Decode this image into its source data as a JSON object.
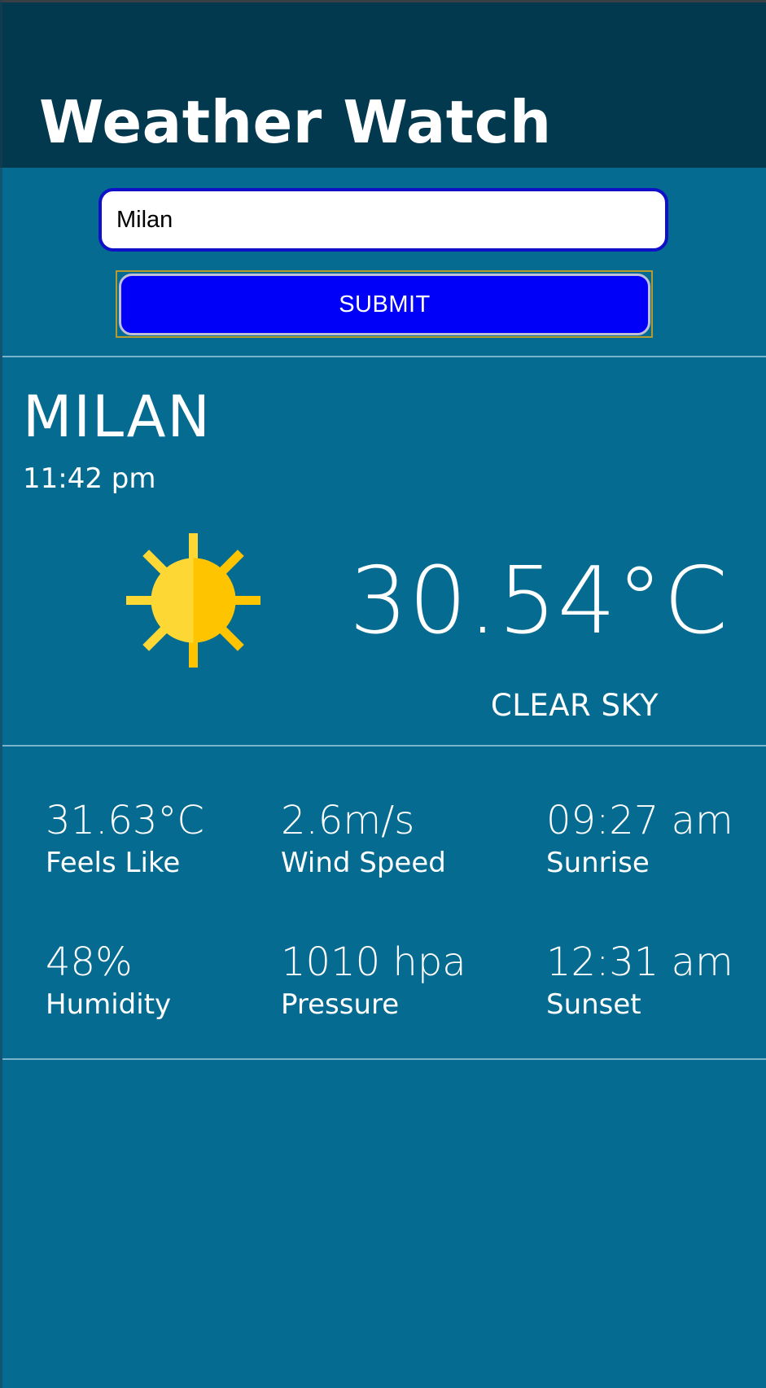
{
  "header": {
    "title": "Weather Watch"
  },
  "search": {
    "value": "Milan",
    "submit_label": "SUBMIT"
  },
  "current": {
    "city": "MILAN",
    "time": "11:42 pm",
    "temperature": "30.54°C",
    "condition": "CLEAR SKY",
    "icon": "sun-icon"
  },
  "stats": {
    "feels_like": {
      "value": "31.63°C",
      "label": "Feels Like"
    },
    "wind_speed": {
      "value": "2.6m/s",
      "label": "Wind Speed"
    },
    "sunrise": {
      "value": "09:27 am",
      "label": "Sunrise"
    },
    "humidity": {
      "value": "48%",
      "label": "Humidity"
    },
    "pressure": {
      "value": "1010 hpa",
      "label": "Pressure"
    },
    "sunset": {
      "value": "12:31 am",
      "label": "Sunset"
    }
  },
  "colors": {
    "header_background": "#02394e",
    "page_background": "#066b91",
    "submit_button": "#0000f8",
    "input_border": "#1010c8",
    "sun_light": "#fdd835",
    "sun_dark": "#ffc400"
  }
}
